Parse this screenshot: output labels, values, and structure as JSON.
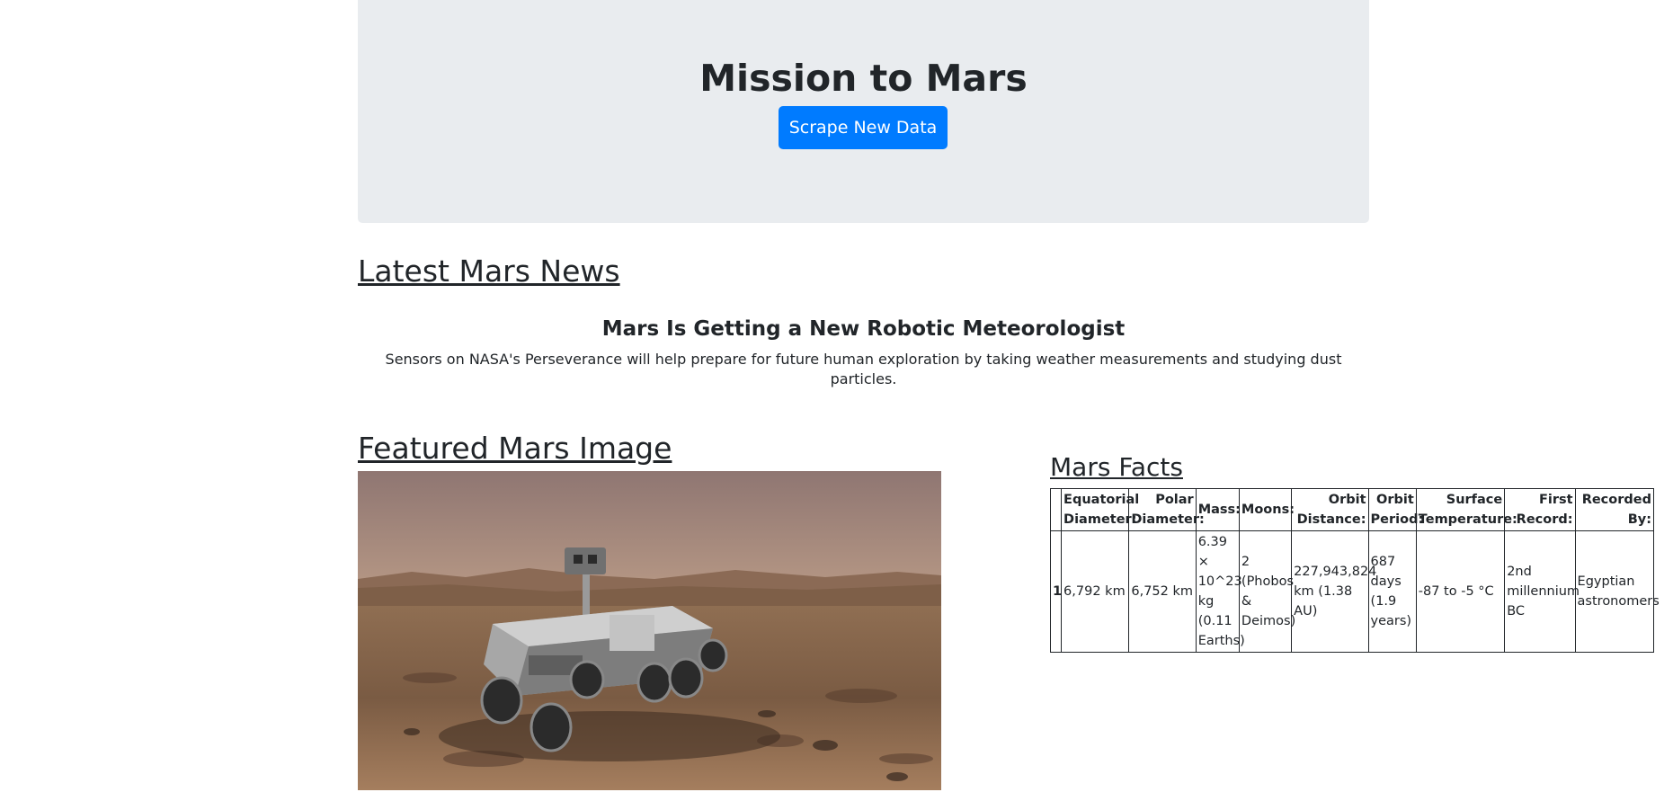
{
  "header": {
    "title": "Mission to Mars",
    "scrape_button_label": "Scrape New Data"
  },
  "news": {
    "section_title": "Latest Mars News",
    "headline": "Mars Is Getting a New Robotic Meteorologist",
    "teaser": "Sensors on NASA's Perseverance will help prepare for future human exploration by taking weather measurements and studying dust particles."
  },
  "featured_image": {
    "section_title": "Featured Mars Image"
  },
  "facts": {
    "section_title": "Mars Facts",
    "columns": [
      "",
      "Equatorial Diameter:",
      "Polar Diameter:",
      "Mass:",
      "Moons:",
      "Orbit Distance:",
      "Orbit Period:",
      "Surface Temperature:",
      "First Record:",
      "Recorded By:"
    ],
    "rows": [
      [
        "1",
        "6,792 km",
        "6,752 km",
        "6.39 × 10^23 kg (0.11 Earths)",
        "2 (Phobos & Deimos)",
        "227,943,824 km (1.38 AU)",
        "687 days (1.9 years)",
        "-87 to -5 °C",
        "2nd millennium BC",
        "Egyptian astronomers"
      ]
    ]
  },
  "colors": {
    "jumbotron_bg": "#e9ecef",
    "primary": "#007bff",
    "text": "#212529"
  }
}
